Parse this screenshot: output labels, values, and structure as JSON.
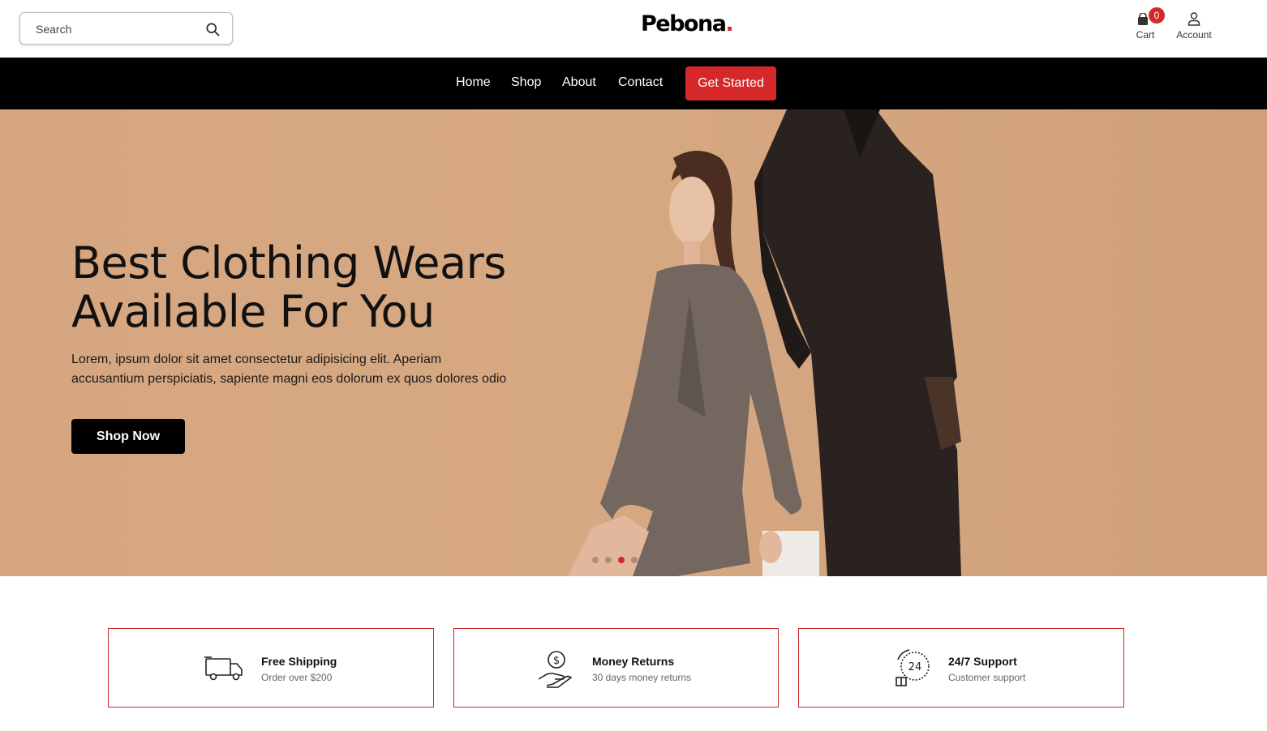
{
  "header": {
    "search": {
      "placeholder": "Search",
      "value": ""
    },
    "logo": {
      "text": "Pebona",
      "dot": "."
    },
    "cart": {
      "label": "Cart",
      "count": "0"
    },
    "account": {
      "label": "Account"
    }
  },
  "nav": {
    "items": [
      {
        "label": "Home"
      },
      {
        "label": "Shop"
      },
      {
        "label": "About"
      },
      {
        "label": "Contact"
      }
    ],
    "cta_label": "Get Started"
  },
  "hero": {
    "title_line1": "Best Clothing Wears",
    "title_line2": "Available For You",
    "text_line1": "Lorem, ipsum dolor sit amet consectetur adipisicing elit. Aperiam",
    "text_line2": "accusantium perspiciatis, sapiente magni eos dolorum ex quos dolores odio",
    "button_label": "Shop Now",
    "slide_count": 4,
    "active_slide": 3
  },
  "features": [
    {
      "icon": "truck-icon",
      "title": "Free Shipping",
      "subtitle": "Order over $200"
    },
    {
      "icon": "money-hand-icon",
      "title": "Money Returns",
      "subtitle": "30 days money returns"
    },
    {
      "icon": "support-24-icon",
      "title": "24/7 Support",
      "subtitle": "Customer support"
    }
  ],
  "colors": {
    "accent": "#d62828",
    "nav_bg": "#000000",
    "hero_bg": "#d3a57d",
    "text": "#111111"
  }
}
